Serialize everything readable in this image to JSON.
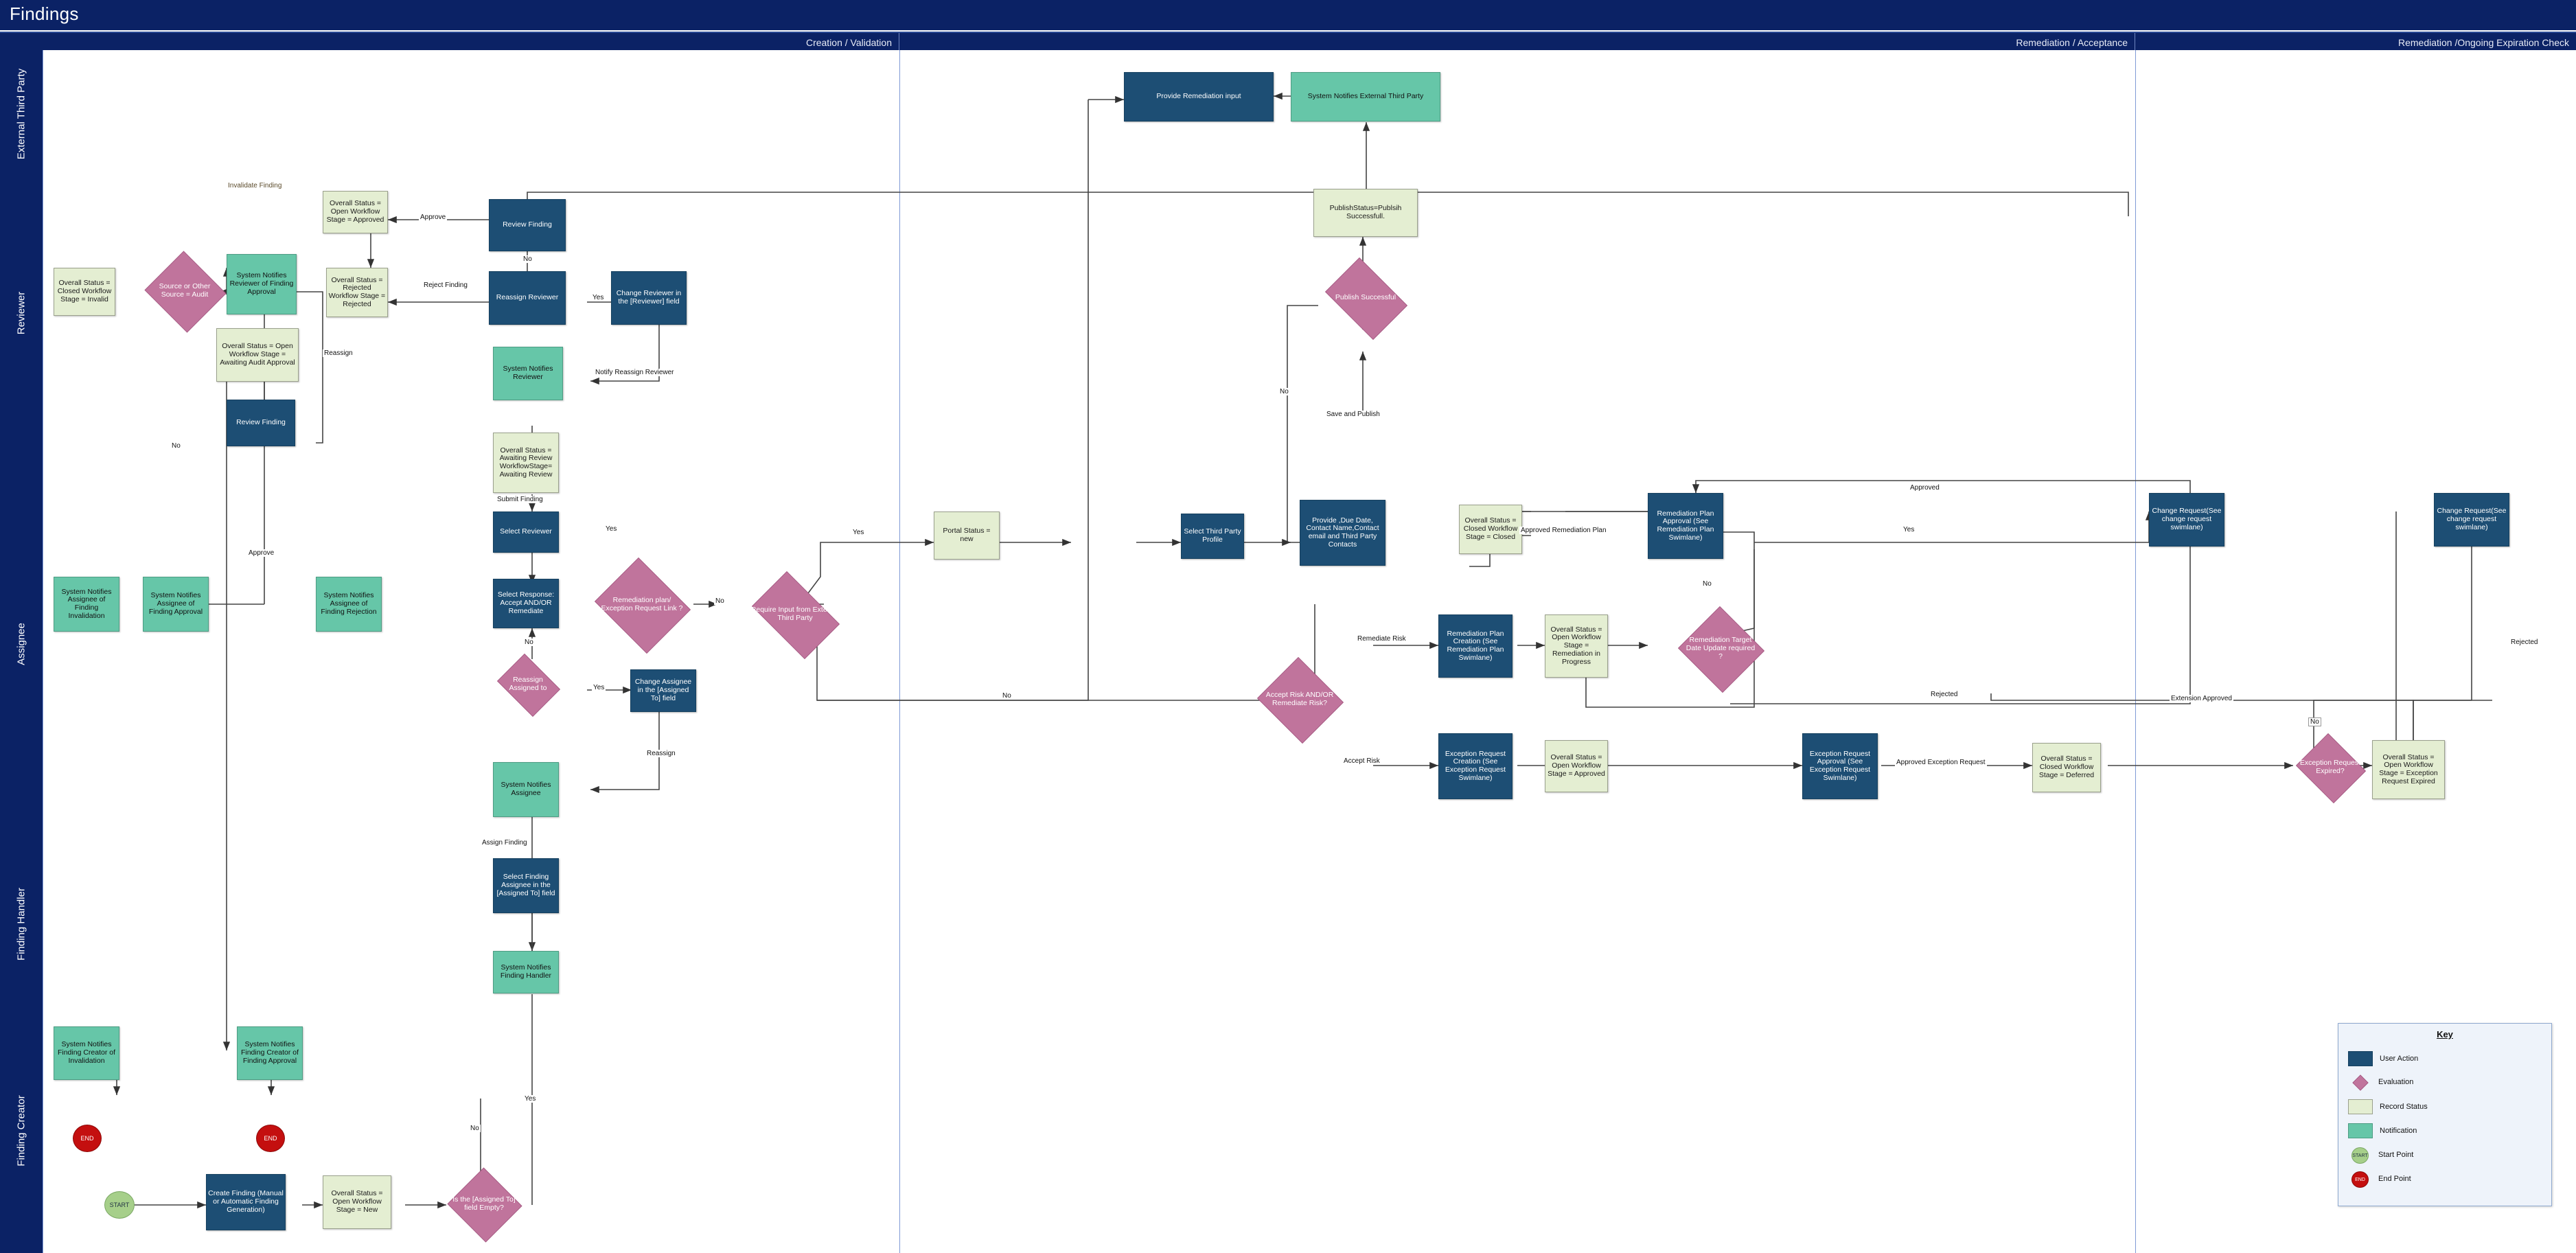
{
  "header": {
    "title": "Findings"
  },
  "phases": [
    {
      "label": "Creation / Validation"
    },
    {
      "label": "Remediation / Acceptance"
    },
    {
      "label": "Remediation /Ongoing Expiration Check"
    }
  ],
  "lanes": [
    {
      "label": "External Third Party"
    },
    {
      "label": "Reviewer"
    },
    {
      "label": "Assignee"
    },
    {
      "label": "Finding Handler"
    },
    {
      "label": "Finding Creator"
    }
  ],
  "nodes": {
    "provide_remediation_input": "Provide Remediation input",
    "system_notifies_etp": "System Notifies External Third Party",
    "publish_status": "PublishStatus=Publsih Successfull.",
    "publish_successful": "Publish Successful",
    "overall_open_approved": "Overall Status = Open Workflow Stage = Approved",
    "review_finding_top": "Review Finding",
    "reassign_reviewer": "Reassign Reviewer",
    "change_reviewer_field": "Change Reviewer in the [Reviewer] field",
    "overall_closed_invalid": "Overall Status = Closed Workflow Stage = Invalid",
    "source_or_other_audit": "Source or Other Source = Audit",
    "system_notifies_reviewer_approval": "System Notifies Reviewer of Finding Approval",
    "overall_rejected": "Overall Status = Rejected Workflow Stage = Rejected",
    "overall_awaiting_audit": "Overall Status = Open Workflow Stage = Awaiting Audit Approval",
    "system_notifies_reviewer": "System Notifies Reviewer",
    "review_finding_bottom": "Review Finding",
    "overall_awaiting_review": "Overall Status = Awaiting Review WorkflowStage= Awaiting Review",
    "select_reviewer": "Select Reviewer",
    "system_notifies_assignee_invalidation": "System Notifies Assignee of Finding Invalidation",
    "system_notifies_assignee_approval": "System Notifies Assignee of Finding Approval",
    "system_notifies_assignee_rejection": "System Notifies Assignee of Finding Rejection",
    "select_response": "Select Response: Accept AND/OR Remediate",
    "remediation_exception_link": "Remediation plan/ Exception Request Link ?",
    "reassign_assigned_to": "Reassign Assigned to",
    "change_assignee_field": "Change Assignee in the [Assigned To] field",
    "system_notifies_assignee": "System Notifies Assignee",
    "require_input_etp": "Require Input from External Third Party",
    "portal_status_new": "Portal Status = new",
    "select_third_party_profile": "Select Third Party Profile",
    "provide_due_date": "Provide ,Due Date, Contact Name,Contact email and Third Party Contacts",
    "overall_closed_closed": "Overall Status = Closed Workflow Stage = Closed",
    "remediation_plan_approval": "Remediation Plan Approval (See Remediation Plan Swimlane)",
    "accept_risk_remediate": "Accept Risk AND/OR Remediate Risk?",
    "remediation_plan_creation": "Remediation Plan Creation (See Remediation Plan Swimlane)",
    "overall_open_remediation_progress": "Overall Status = Open Workflow Stage = Remediation in Progress",
    "remediation_target_date": "Remediation Target Date Update required ?",
    "change_request_1": "Change Request(See change request swimlane)",
    "change_request_2": "Change Request(See change request swimlane)",
    "exception_request_creation": "Exception Request Creation (See Exception Request Swimlane)",
    "overall_open_approved_2": "Overall Status = Open Workflow Stage = Approved",
    "exception_request_approval": "Exception Request Approval (See Exception Request Swimlane)",
    "overall_closed_deferred": "Overall Status = Closed Workflow Stage = Deferred",
    "exception_request_expired": "Exception Request Expired?",
    "overall_open_exception_expired": "Overall Status = Open Workflow Stage = Exception Request Expired",
    "select_finding_assignee": "Select Finding Assignee in the [Assigned To] field",
    "system_notifies_finding_handler": "System Notifies Finding Handler",
    "system_notifies_creator_invalidation": "System Notifies Finding Creator of Invalidation",
    "system_notifies_creator_approval": "System Notifies Finding Creator of Finding Approval",
    "end_1": "END",
    "end_2": "END",
    "start": "START",
    "create_finding": "Create Finding (Manual or Automatic Finding Generation)",
    "overall_open_new": "Overall Status = Open Workflow Stage = New",
    "assigned_to_empty": "Is the [Assigned To] field Empty?"
  },
  "edge_labels": {
    "invalidate_finding": "Invalidate Finding",
    "approve_top": "Approve",
    "no_review_top": "No",
    "reject_finding": "Reject Finding",
    "yes_reassign_reviewer": "Yes",
    "notify_reassign_reviewer": "Notify Reassign Reviewer",
    "reassign_reviewer_lbl": "Reassign",
    "no_source": "No",
    "approve_assignee": "Approve",
    "submit_finding": "Submit Finding",
    "yes_select_reviewer": "Yes",
    "no_link": "No",
    "no_select_response": "No",
    "yes_reassign_assigned": "Yes",
    "reassign_assignee": "Reassign",
    "yes_require_input": "Yes",
    "no_require_input": "No",
    "save_and_publish": "Save and Publish",
    "no_publish": "No",
    "remediate_risk": "Remediate Risk",
    "accept_risk": "Accept Risk",
    "approved_remediation_plan": "Approved Remediation Plan",
    "approved_top": "Approved",
    "no_target_date": "No",
    "yes_target_date": "Yes",
    "rejected_plan": "Rejected",
    "approved_exception_request": "Approved Exception Request",
    "extension_approved": "Extension Approved",
    "rejected_right": "Rejected",
    "no_expired": "No",
    "assign_finding": "Assign Finding",
    "yes_empty": "Yes",
    "no_empty": "No"
  },
  "key": {
    "title": "Key",
    "items": [
      {
        "label": "User Action",
        "shape": "rect",
        "color": "#1d4e74"
      },
      {
        "label": "Evaluation",
        "shape": "diamond",
        "color": "#c0749c"
      },
      {
        "label": "Record Status",
        "shape": "rect",
        "color": "#e4eed2"
      },
      {
        "label": "Notification",
        "shape": "rect",
        "color": "#66c6a8"
      },
      {
        "label": "Start Point",
        "shape": "circle",
        "color": "#a6cf8a",
        "text": "START"
      },
      {
        "label": "End Point",
        "shape": "circle",
        "color": "#c40f0f",
        "text": "END"
      }
    ]
  }
}
